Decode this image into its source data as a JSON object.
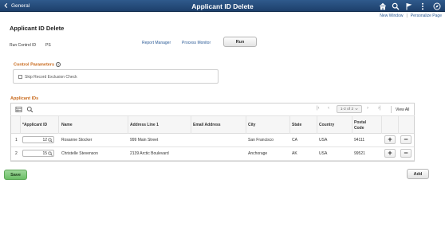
{
  "banner": {
    "back_label": "General",
    "title": "Applicant ID Delete",
    "icons": [
      "home-icon",
      "search-icon",
      "flag-icon",
      "more-icon",
      "navigator-icon"
    ]
  },
  "top_links": {
    "new_window": "New Window",
    "separator": "|",
    "personalize": "Personalize Page"
  },
  "page": {
    "title": "Applicant ID Delete"
  },
  "run_control": {
    "label": "Run Control ID",
    "value": "PS",
    "report_manager": "Report Manager",
    "process_monitor": "Process Monitor",
    "run_label": "Run"
  },
  "control_parameters": {
    "title": "Control Parameters",
    "help": "?",
    "skip_label": "Skip Record Exclusion Check",
    "skip_checked": false
  },
  "grid": {
    "title": "Applicant IDs",
    "pager_text": "1-2 of 2",
    "view_all": "View All",
    "columns": [
      "*Applicant ID",
      "Name",
      "Address Line 1",
      "Email Address",
      "City",
      "State",
      "Country",
      "Postal Code"
    ],
    "rows": [
      {
        "num": "1",
        "applicant_id": "12",
        "name": "Rosanne Stocker",
        "address": "999 Main Street",
        "email": "",
        "city": "San Francisco",
        "state": "CA",
        "country": "USA",
        "postal": "94111"
      },
      {
        "num": "2",
        "applicant_id": "15",
        "name": "Christelle Stevenson",
        "address": "2139 Arctic Boulevard",
        "email": "",
        "city": "Anchorage",
        "state": "AK",
        "country": "USA",
        "postal": "99521"
      }
    ],
    "add_row_symbol": "+",
    "delete_row_symbol": "−"
  },
  "footer": {
    "save_label": "Save",
    "add_label": "Add"
  },
  "colors": {
    "banner": "#1d3f6b",
    "section_label": "#c96b1e",
    "link": "#2a5a96",
    "save": "#6cbf67"
  }
}
